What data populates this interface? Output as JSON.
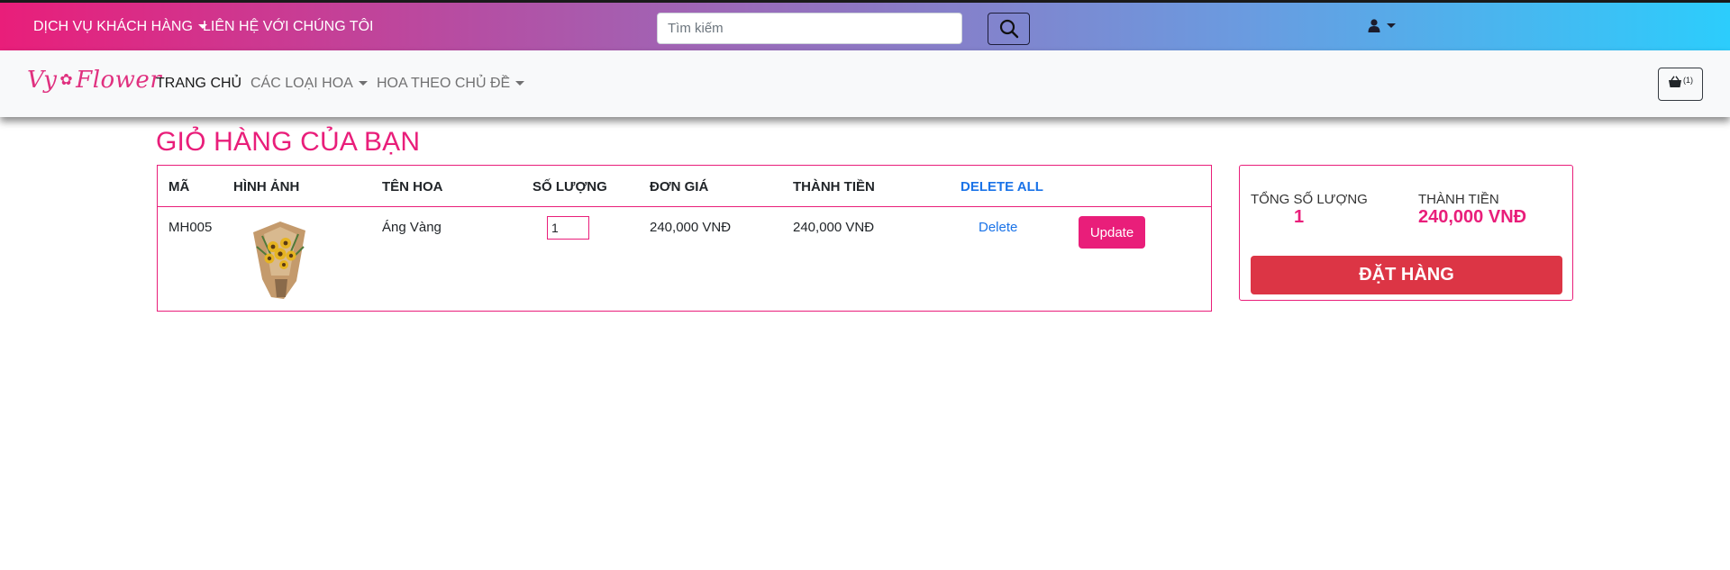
{
  "topbar": {
    "customer_service": "DỊCH VỤ KHÁCH HÀNG",
    "contact": "LIÊN HỆ VỚI CHÚNG TÔI",
    "search_placeholder": "Tìm kiếm"
  },
  "brand": {
    "name_part1": "Vy",
    "name_part2": "Flower"
  },
  "nav": {
    "home": "TRANG CHỦ",
    "flower_types": "CÁC LOẠI HOA",
    "by_theme": "HOA THEO CHỦ ĐỀ",
    "cart_count": "(1)"
  },
  "page_title": "GIỎ HÀNG CỦA BẠN",
  "cart": {
    "headers": {
      "code": "MÃ",
      "image": "HÌNH ẢNH",
      "name": "TÊN HOA",
      "quantity": "SỐ LƯỢNG",
      "unit_price": "ĐƠN GIÁ",
      "total": "THÀNH TIỀN",
      "delete_all": "DELETE ALL"
    },
    "items": [
      {
        "code": "MH005",
        "name": "Áng Vàng",
        "quantity": "1",
        "unit_price": "240,000 VNĐ",
        "total": "240,000 VNĐ",
        "delete_label": "Delete",
        "update_label": "Update"
      }
    ]
  },
  "summary": {
    "qty_label": "TỔNG SỐ LƯỢNG",
    "qty_value": "1",
    "total_label": "THÀNH TIỀN",
    "total_value": "240,000 VNĐ",
    "order_button": "ĐẶT HÀNG"
  },
  "colors": {
    "brand_pink": "#e91e7a",
    "link_blue": "#1a73e8",
    "order_red": "#dc3545",
    "gradient_start": "#e91e7a",
    "gradient_end": "#2ccdfc"
  }
}
